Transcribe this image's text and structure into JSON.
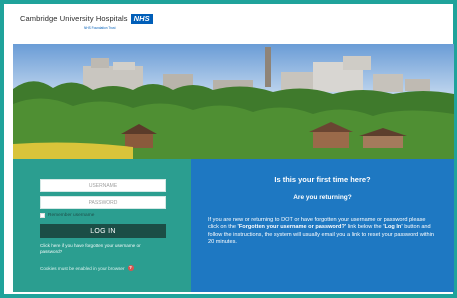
{
  "header": {
    "hospital_name": "Cambridge University Hospitals",
    "nhs_badge": "NHS",
    "trust_label": "NHS Foundation Trust"
  },
  "login": {
    "username_placeholder": "USERNAME",
    "password_placeholder": "PASSWORD",
    "remember_label": "Remember username",
    "login_button": "LOG IN",
    "forgot_link": "Click here if you have forgotten your username or password?",
    "cookies_notice": "Cookies must be enabled in your browser",
    "info_icon_glyph": "?"
  },
  "info": {
    "title": "Is this your first time here?",
    "subtitle": "Are you returning?",
    "body_part1": "If you are new or returning to DOT or have forgotten your username or password please click on the ",
    "body_bold1": "'Forgotten your username or password?'",
    "body_part2": " link below the ",
    "body_bold2": "'Log In'",
    "body_part3": " button and follow the instructions, the system will usually email you a link to reset your password within 20 minutes."
  },
  "colors": {
    "frame": "#1fa39b",
    "login_panel": "#2b9e90",
    "login_button": "#1b4e46",
    "info_panel": "#1e78c2",
    "nhs_blue": "#005eb8"
  }
}
